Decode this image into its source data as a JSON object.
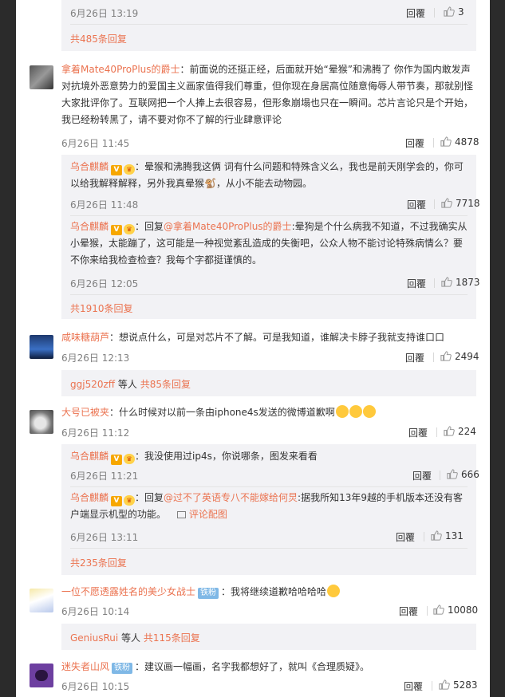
{
  "c0": {
    "time": "6月26日 13:19",
    "reply": "回覆",
    "likes": "3",
    "more": "共485条回复"
  },
  "c1": {
    "user": "拿着Mate40ProPlus的爵士",
    "text": "：前面说的还挺正经，后面就开始“晕猴”和沸腾了 你作为国内敢发声对抗境外恶意势力的爱国主义画家值得我们尊重，但你现在身居高位随意侮辱人带节奏，那就别怪大家批评你了。互联网把一个人捧上去很容易，但形象崩塌也只在一瞬间。芯片言论只是个开始，我已经粉转黑了，请不要对你不了解的行业肆意评论",
    "time": "6月26日 11:45",
    "reply": "回覆",
    "likes": "4878",
    "subs": [
      {
        "user": "乌合麒麟",
        "text": "：晕猴和沸腾我这俩 词有什么问题和特殊含义么，我也是前天刚学会的，你可以给我解释解释，另外我真晕猴🐒，从小不能去动物园。",
        "time": "6月26日 11:48",
        "reply": "回覆",
        "likes": "7718"
      },
      {
        "user": "乌合麒麟",
        "prefix": "：回复",
        "mention": "@拿着Mate40ProPlus的爵士",
        "text": ":晕狗是个什么病我不知道，不过我确实从小晕猴，太能蹦了，这可能是一种视觉紊乱造成的失衡吧，公众人物不能讨论特殊病情么？要不你来给我检查检查？我每个字都挺谨慎的。",
        "time": "6月26日 12:05",
        "reply": "回覆",
        "likes": "1873"
      }
    ],
    "more": "共1910条回复"
  },
  "c2": {
    "user": "咸味糖葫芦",
    "text": "：想说点什么，可是对芯片不了解。可是我知道，谁解决卡脖子我就支持谁口口",
    "time": "6月26日 12:13",
    "reply": "回覆",
    "likes": "2494",
    "sub_user": "ggj520zff",
    "sub_mid": " 等人 ",
    "more": "共85条回复"
  },
  "c3": {
    "user": "大号已被夹",
    "text": "：什么时候对以前一条由iphone4s发送的微博道歉啊",
    "time": "6月26日 11:12",
    "reply": "回覆",
    "likes": "224",
    "subs": [
      {
        "user": "乌合麒麟",
        "text": "：我没使用过ip4s，你说哪条，图发来看看",
        "time": "6月26日 11:21",
        "reply": "回覆",
        "likes": "666"
      },
      {
        "user": "乌合麒麟",
        "prefix": "：回复",
        "mention": "@过不了英语专八不能嫁给何炅",
        "text": ":据我所知13年9越的手机版本还没有客户端显示机型的功能。",
        "pic_label": "评论配图",
        "time": "6月26日 13:11",
        "reply": "回覆",
        "likes": "131"
      }
    ],
    "more": "共235条回复"
  },
  "c4": {
    "user": "一位不愿透露姓名的美少女战士",
    "badge": "铁粉",
    "text": "：我将继续道歉哈哈哈哈",
    "time": "6月26日 10:14",
    "reply": "回覆",
    "likes": "10080",
    "sub_user": "GeniusRui",
    "sub_mid": " 等人 ",
    "more": "共115条回复"
  },
  "c5": {
    "user": "迷失者山风",
    "badge": "铁粉",
    "text": "：建议画一幅画，名字我都想好了，就叫《合理质疑》。",
    "time": "6月26日 10:15",
    "reply": "回覆",
    "likes": "5283"
  },
  "colors": {
    "accent": "#eb7350",
    "meta": "#808080",
    "subbox": "#f2f2f5",
    "badge_v": "#f7a700",
    "fan": "#7fb8e6"
  },
  "icons": {
    "like": "thumbs-up-icon",
    "vip": "v-verified-badge",
    "crown": "crown-badge",
    "pic": "image-icon"
  }
}
